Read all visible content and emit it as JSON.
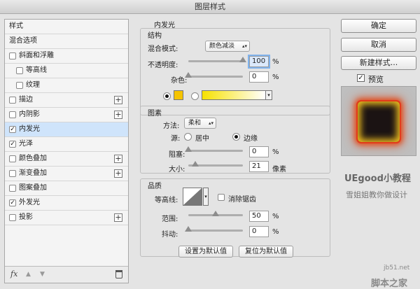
{
  "window": {
    "title": "图层样式"
  },
  "left_panel": {
    "header": "样式",
    "blend_options": "混合选项",
    "items": [
      {
        "label": "斜面和浮雕",
        "checked": false,
        "plus": false
      },
      {
        "label": "等高线",
        "checked": false,
        "plus": false,
        "sub": true
      },
      {
        "label": "纹理",
        "checked": false,
        "plus": false,
        "sub": true
      },
      {
        "label": "描边",
        "checked": false,
        "plus": true
      },
      {
        "label": "内阴影",
        "checked": false,
        "plus": true
      },
      {
        "label": "内发光",
        "checked": true,
        "plus": false,
        "selected": true
      },
      {
        "label": "光泽",
        "checked": true,
        "plus": false
      },
      {
        "label": "颜色叠加",
        "checked": false,
        "plus": true
      },
      {
        "label": "渐变叠加",
        "checked": false,
        "plus": true
      },
      {
        "label": "图案叠加",
        "checked": false,
        "plus": false
      },
      {
        "label": "外发光",
        "checked": true,
        "plus": false
      },
      {
        "label": "投影",
        "checked": false,
        "plus": true
      }
    ],
    "footer": {
      "fx": "fx",
      "up": "▲",
      "down": "▼",
      "trash": "🗑"
    }
  },
  "inner_glow": {
    "section_title": "内发光",
    "structure": {
      "title": "结构",
      "blend_mode_label": "混合模式:",
      "blend_mode_value": "颜色减淡",
      "opacity_label": "不透明度:",
      "opacity_value": "100",
      "opacity_percent": 1.0,
      "noise_label": "杂色:",
      "noise_value": "0",
      "noise_percent": 0.0,
      "percent_unit": "%",
      "color": "#f5c400",
      "gradient_from": "#f7e100",
      "gradient_to": "#ffffff"
    },
    "elements": {
      "title": "图素",
      "method_label": "方法:",
      "method_value": "柔和",
      "source_label": "源:",
      "source_center": "居中",
      "source_edge": "边缘",
      "choke_label": "阻塞:",
      "choke_value": "0",
      "choke_percent": 0.0,
      "size_label": "大小:",
      "size_value": "21",
      "size_unit": "像素",
      "percent_unit": "%"
    },
    "quality": {
      "title": "品质",
      "contour_label": "等高线:",
      "anti_alias_label": "消除锯齿",
      "anti_alias_checked": false,
      "range_label": "范围:",
      "range_value": "50",
      "range_percent": 0.5,
      "jitter_label": "抖动:",
      "jitter_value": "0",
      "jitter_percent": 0.0,
      "percent_unit": "%"
    },
    "make_default": "设置为默认值",
    "reset_default": "复位为默认值"
  },
  "right_panel": {
    "ok": "确定",
    "cancel": "取消",
    "new_style": "新建样式...",
    "preview_label": "预览",
    "preview_checked": true
  },
  "overlay": {
    "brand": "UEgood小教程",
    "subtitle": "雪姐姐教你做设计",
    "site": "jb51.net",
    "site_cn": "脚本之家"
  }
}
